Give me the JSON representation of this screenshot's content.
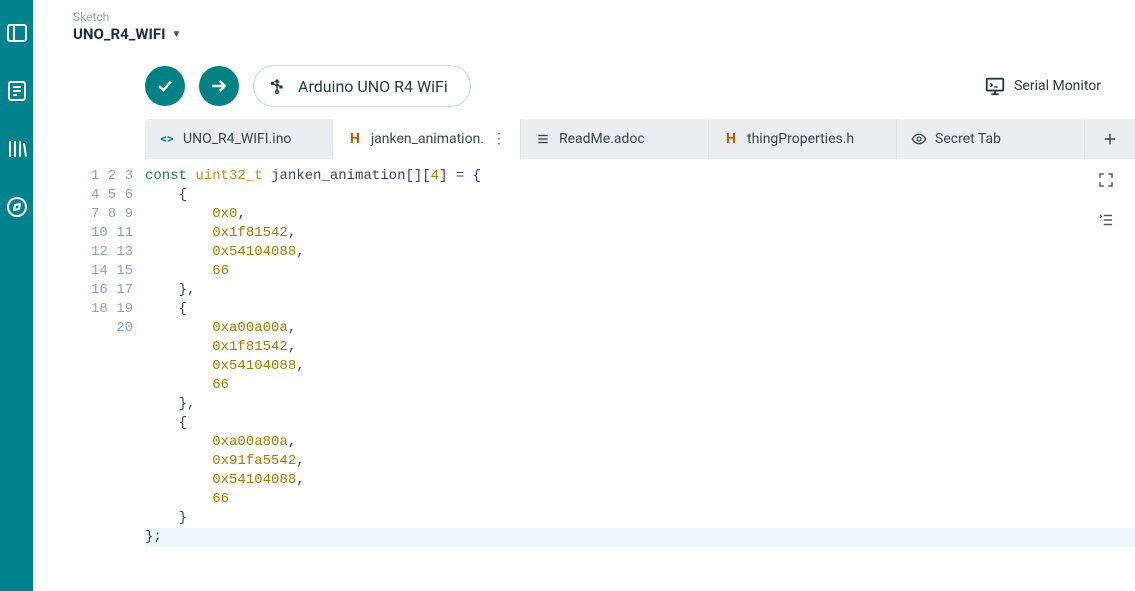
{
  "header": {
    "sketch_label": "Sketch",
    "sketch_name": "UNO_R4_WIFI"
  },
  "toolbar": {
    "board_name": "Arduino UNO R4 WiFi",
    "serial_monitor_label": "Serial Monitor"
  },
  "tabs": [
    {
      "icon": "code",
      "label": "UNO_R4_WIFI.ino"
    },
    {
      "icon": "h",
      "label": "janken_animation.h",
      "active": true,
      "truncated": "janken_animation."
    },
    {
      "icon": "lines",
      "label": "ReadMe.adoc"
    },
    {
      "icon": "h",
      "label": "thingProperties.h"
    },
    {
      "icon": "secret",
      "label": "Secret Tab"
    }
  ],
  "code": {
    "lines": [
      "const uint32_t janken_animation[][4] = {",
      "    {",
      "        0x0,",
      "        0x1f81542,",
      "        0x54104088,",
      "        66",
      "    },",
      "    {",
      "        0xa00a00a,",
      "        0x1f81542,",
      "        0x54104088,",
      "        66",
      "    },",
      "    {",
      "        0xa00a80a,",
      "        0x91fa5542,",
      "        0x54104088,",
      "        66",
      "    }",
      "};"
    ],
    "line_count": 20,
    "highlighted_line": 20
  }
}
